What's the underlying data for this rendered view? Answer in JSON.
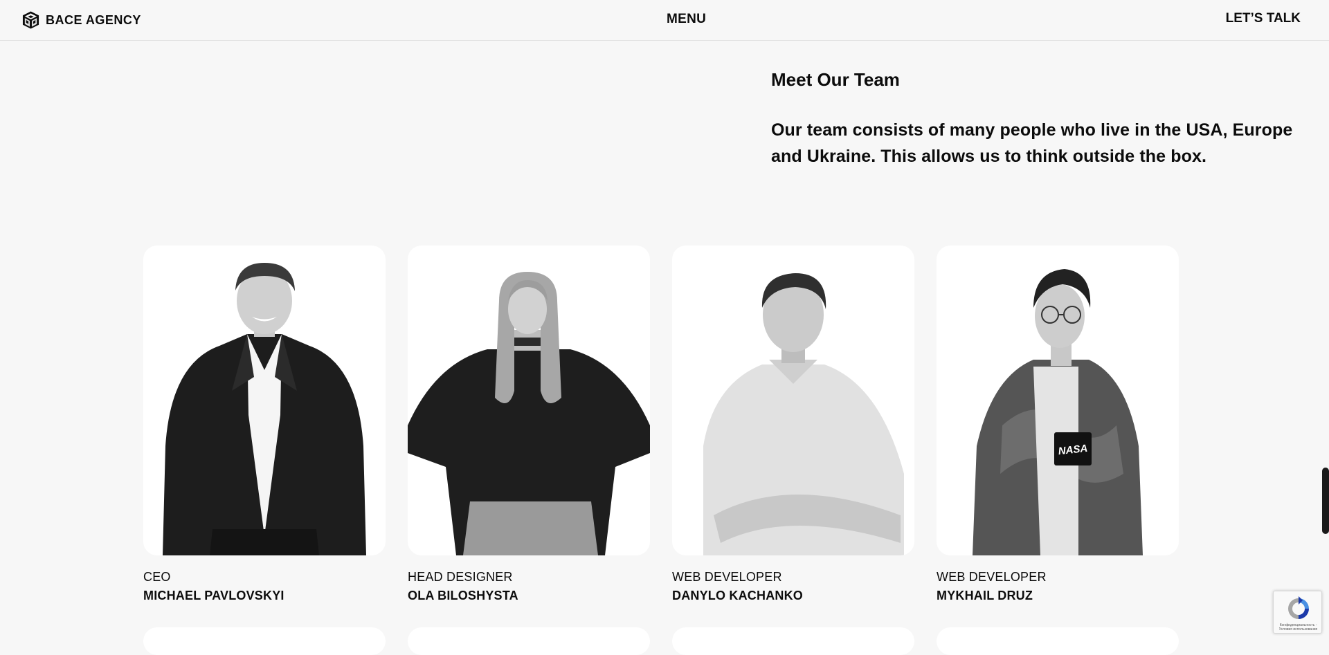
{
  "header": {
    "logo_text": "BACE AGENCY",
    "menu_label": "MENU",
    "cta_label": "LET’S TALK"
  },
  "intro": {
    "title": "Meet Our Team",
    "text": "Our team consists of many people who live in the USA, Europe and Ukraine. This allows us to think outside the box."
  },
  "team": [
    {
      "role": "CEO",
      "name": "MICHAEL PAVLOVSKYI"
    },
    {
      "role": "HEAD DESIGNER",
      "name": "OLA BILOSHYSTA"
    },
    {
      "role": "WEB DEVELOPER",
      "name": "DANYLO KACHANKO"
    },
    {
      "role": "WEB DEVELOPER",
      "name": "MYKHAIL DRUZ"
    }
  ],
  "badges": {
    "nasa_patch": "NASA"
  },
  "recaptcha": {
    "text": "Конфиденциальность - Условия использования"
  },
  "colors": {
    "background": "#f7f7f7",
    "card": "#ffffff",
    "text": "#0c0c0c"
  }
}
